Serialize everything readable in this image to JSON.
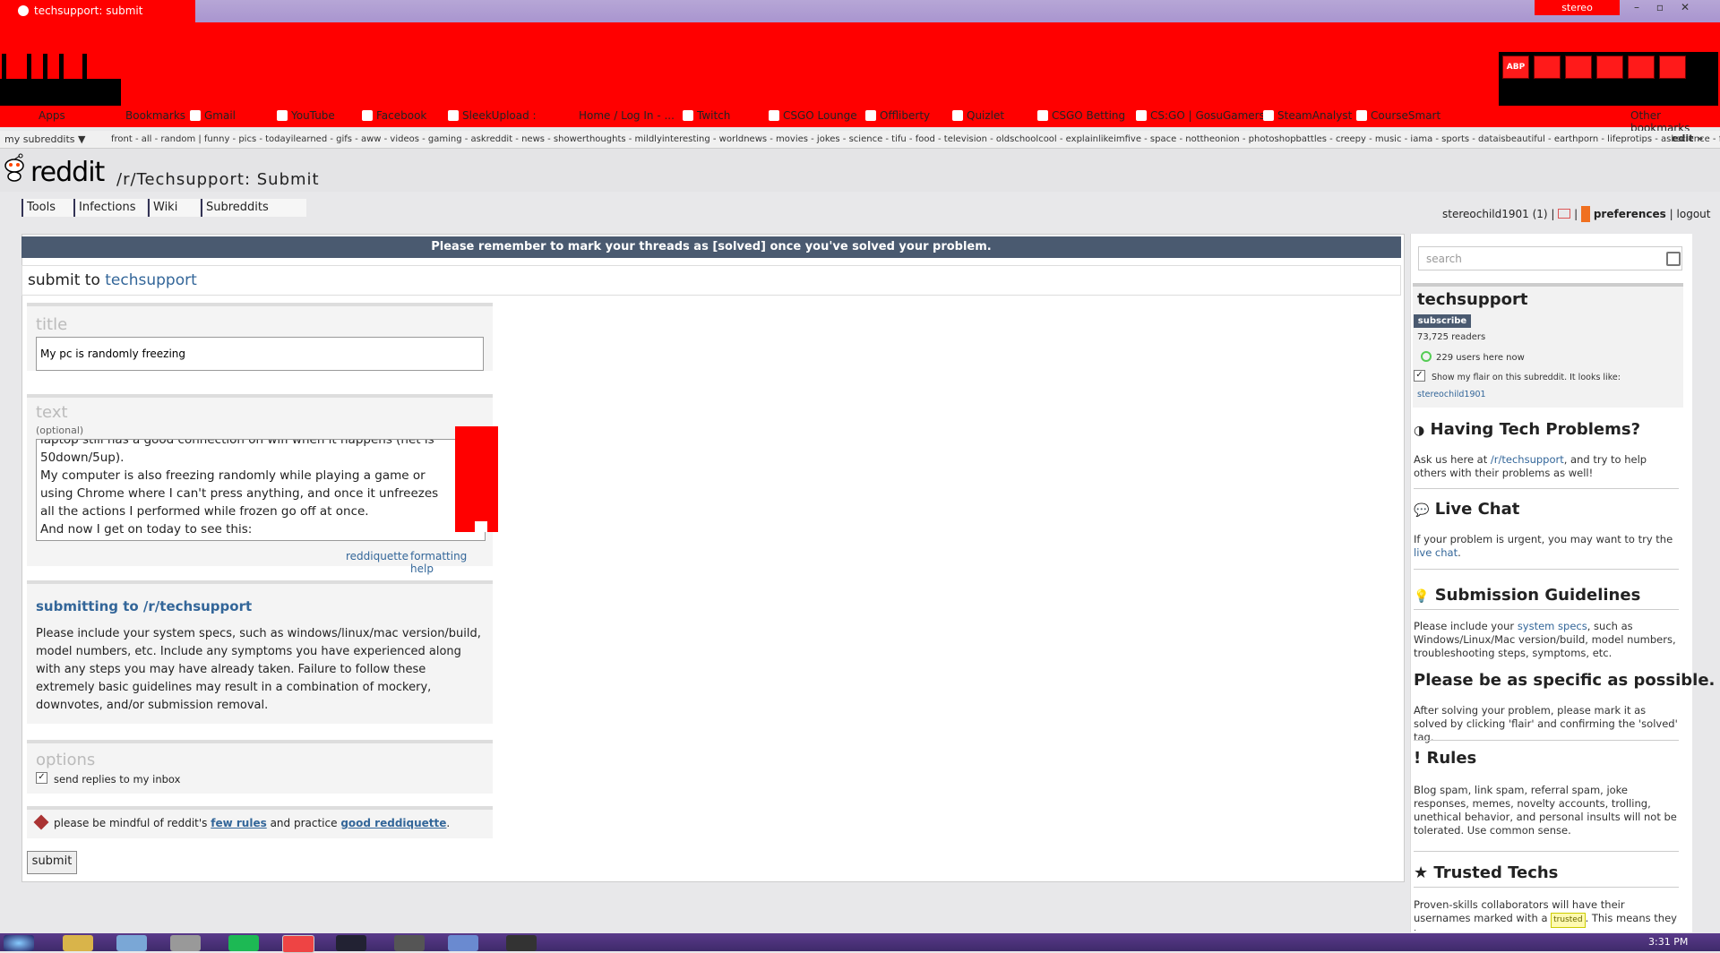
{
  "browser": {
    "tab_title": "techsupport: submit",
    "profile": "stereo",
    "window_controls": [
      "–",
      "▫",
      "✕"
    ],
    "extensions": [
      "ABP",
      "",
      "",
      "",
      "",
      ""
    ]
  },
  "bookmarks": {
    "items": [
      "Apps",
      "Bookmarks",
      "Gmail",
      "YouTube",
      "Facebook",
      "SleekUpload :",
      "Home / Log In - ...",
      "Twitch",
      "CSGO Lounge",
      "Offliberty",
      "Quizlet",
      "CSGO Betting",
      "CS:GO | GosuGamers",
      "SteamAnalyst",
      "CourseSmart"
    ],
    "other": "Other bookmarks"
  },
  "srbar": {
    "my_subreddits": "my subreddits ▼",
    "list": "front - all - random  |  funny - pics - todayilearned - gifs - aww - videos - gaming - askreddit - news - showerthoughts - mildlyinteresting - worldnews - movies - jokes - science - tifu - food - television - oldschoolcool - explainlikeimfive - space - nottheonion - photoshopbattles - creepy - music - iama - sports - dataisbeautiful - earthporn - lifeprotips - askscience - futurology - tw",
    "edit": "edit »"
  },
  "header": {
    "logo": "reddit",
    "page_name": "/r/Techsupport: Submit",
    "tabs": [
      "Tools",
      "Infections",
      "Wiki",
      "Subreddits"
    ],
    "user": "stereochild1901",
    "karma": "(1)",
    "sep1": "|",
    "sep2": "|",
    "preferences": "preferences",
    "sep3": "|",
    "logout": "logout"
  },
  "announce": "Please remember to mark your threads as [solved] once you've solved your problem.",
  "submit": {
    "prefix": "submit to",
    "subreddit": "techsupport",
    "title_label": "title",
    "title_value": "My pc is randomly freezing",
    "text_label": "text",
    "optional": "(optional)",
    "text_lines": [
      "laptop still has a good connection on wifi when it happens (net is",
      "50down/5up).",
      "My computer is also freezing randomly while playing a game or",
      "using Chrome where I can't press anything, and once it unfreezes",
      "all the actions I performed while frozen go off at once.",
      "And now I get on today to see this:"
    ],
    "link_reddiquette": "reddiquette",
    "link_formatting": "formatting help",
    "info_heading": "submitting to /r/techsupport",
    "info_text": "Please include your system specs, such as windows/linux/mac version/build, model numbers, etc. Include any symptoms you have experienced along with any steps you may have already taken. Failure to follow these extremely basic guidelines may result in a combination of mockery, downvotes, and/or submission removal.",
    "options_label": "options",
    "send_replies": "send replies to my inbox",
    "mindful_a": "please be mindful of reddit's",
    "few_rules": "few rules",
    "mindful_b": "and practice",
    "good_reddiquette": "good reddiquette",
    "period": ".",
    "submit_button": "submit"
  },
  "sidebar": {
    "search_placeholder": "search",
    "subreddit": "techsupport",
    "subscribe": "subscribe",
    "readers": "73,725 readers",
    "online": "229 users here now",
    "flair_text": "Show my flair on this subreddit. It looks like:",
    "flair_user": "stereochild1901",
    "h_problems": "Having Tech Problems?",
    "p_problems_a": "Ask us here at",
    "p_problems_link": "/r/techsupport",
    "p_problems_b": ", and try to help others with their problems as well!",
    "h_chat": "Live Chat",
    "p_chat_a": "If your problem is urgent, you may want to try the",
    "p_chat_link": "live chat",
    "p_chat_b": ".",
    "h_guidelines": "Submission Guidelines",
    "p_guidelines_a": "Please include your",
    "p_guidelines_link": "system specs",
    "p_guidelines_b": ", such as Windows/Linux/Mac version/build, model numbers, troubleshooting steps, symptoms, etc.",
    "h_specific": "Please be as specific as possible.",
    "p_specific": "After solving your problem, please mark it as solved by clicking 'flair' and confirming the 'solved' tag.",
    "h_rules": "Rules",
    "p_rules": "Blog spam, link spam, referral spam, joke responses, memes, novelty accounts, trolling, unethical behavior, and personal insults will not be tolerated. Use common sense.",
    "h_trusted": "Trusted Techs",
    "p_trusted_a": "Proven-skills collaborators will have their usernames marked with a",
    "trusted_badge": "trusted",
    "p_trusted_b": ". This means they have proven"
  },
  "taskbar": {
    "clock": "3:31 PM"
  }
}
